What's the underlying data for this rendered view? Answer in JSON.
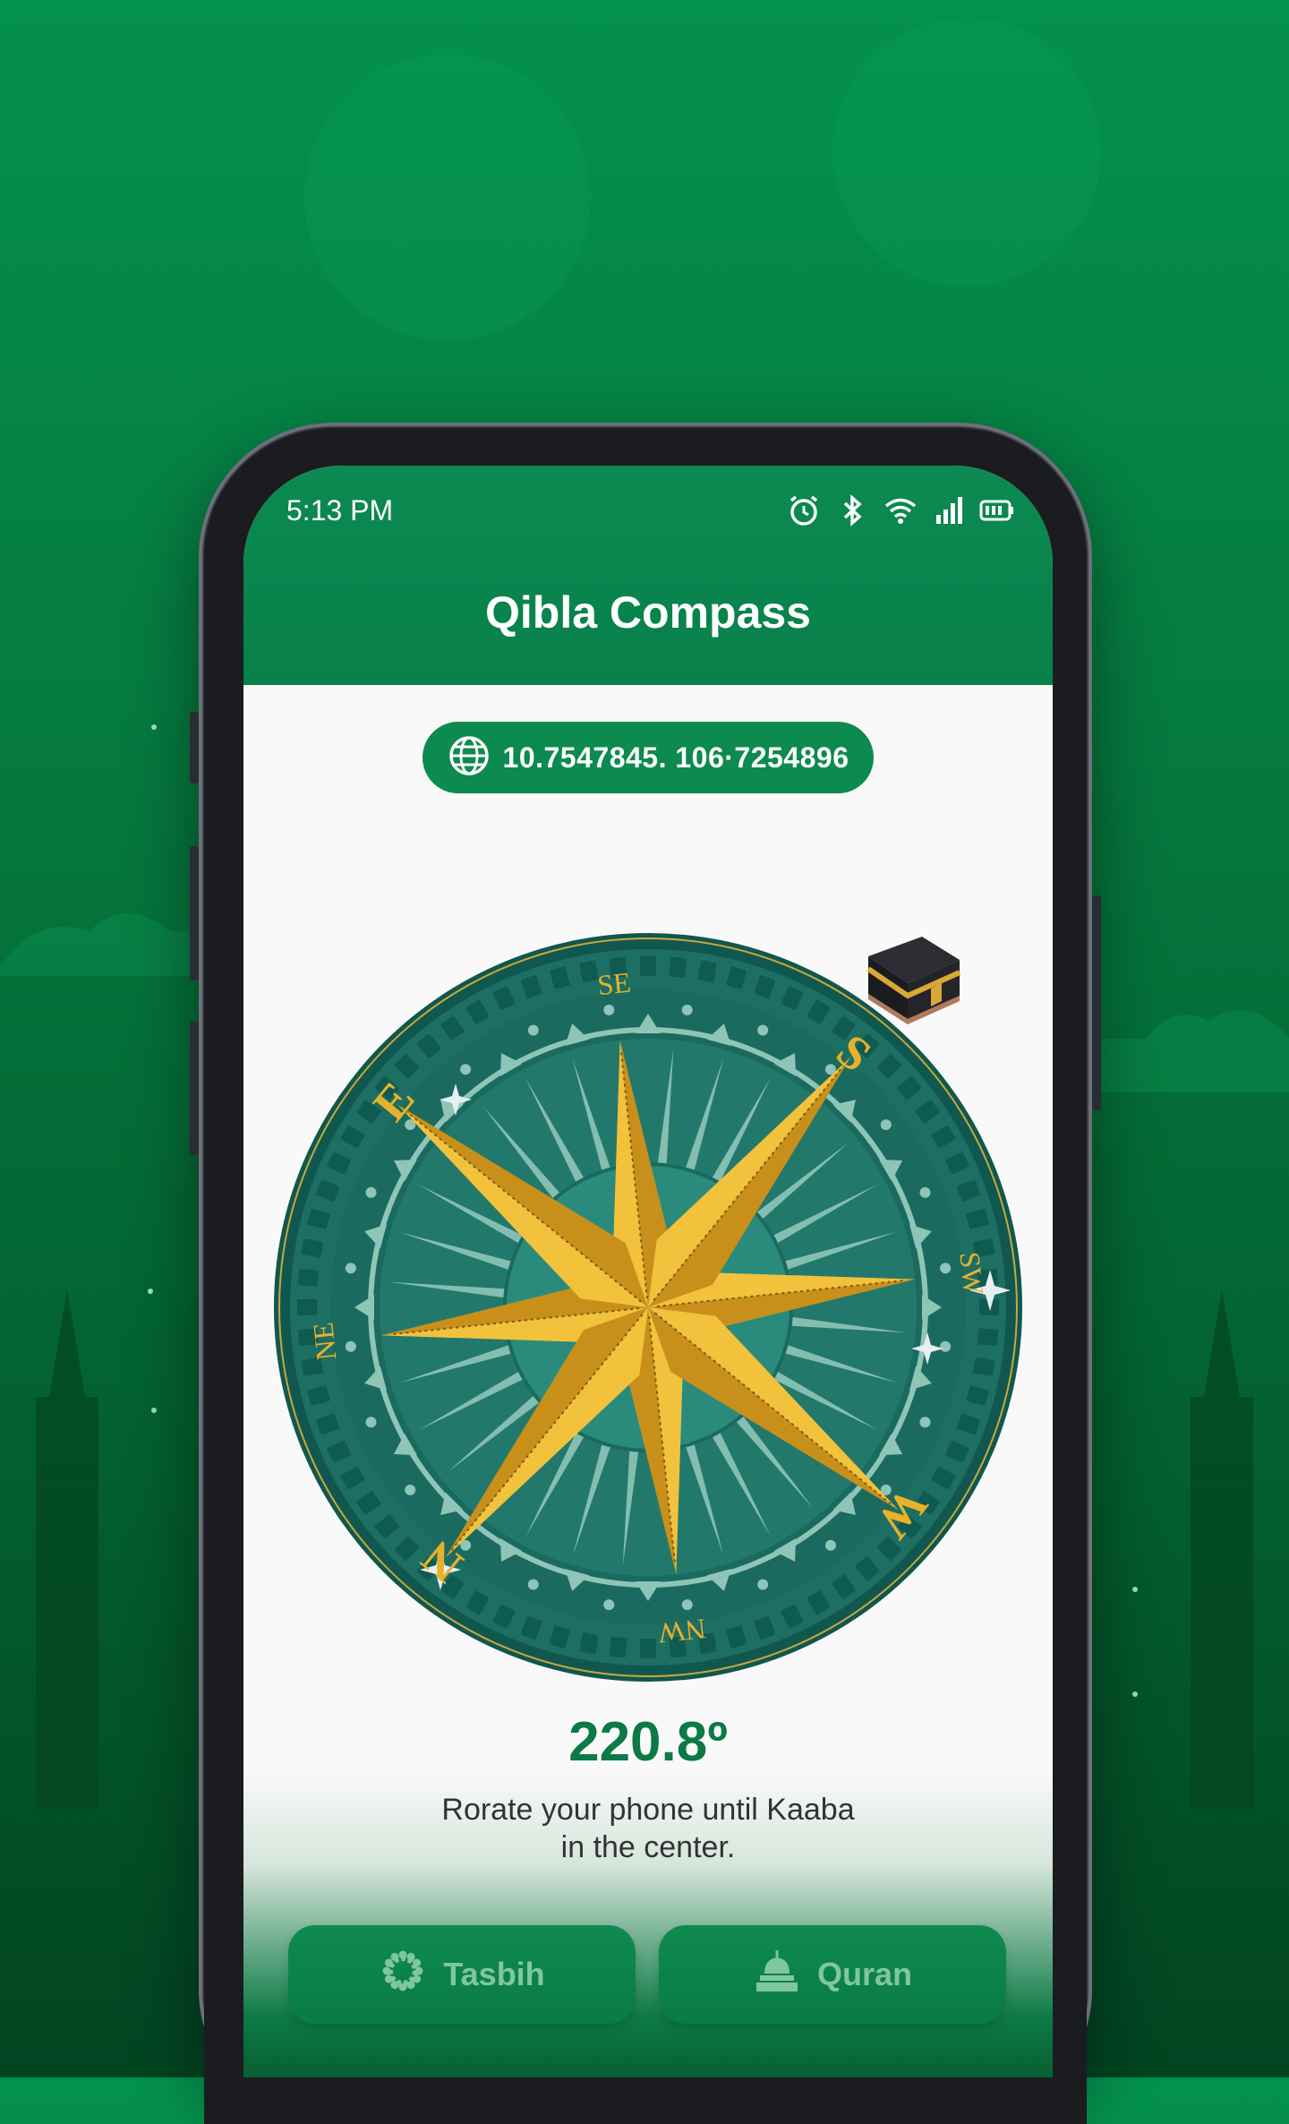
{
  "status_bar": {
    "time": "5:13 PM",
    "icons": [
      "alarm-icon",
      "bluetooth-icon",
      "wifi-icon",
      "signal-icon",
      "battery-icon"
    ]
  },
  "app": {
    "title": "Qibla Compass"
  },
  "location": {
    "coordinates": "10.7547845. 106·7254896",
    "icon": "globe-icon"
  },
  "compass": {
    "labels": [
      "N",
      "NE",
      "E",
      "SE",
      "S",
      "SW",
      "W",
      "NW"
    ],
    "heading": "220.8º",
    "qibla_icon": "kaaba-icon"
  },
  "instruction": {
    "line1": "Rorate your phone until Kaaba",
    "line2": "in the center."
  },
  "actions": [
    {
      "label": "Tasbih",
      "icon": "tasbih-beads-icon"
    },
    {
      "label": "Quran",
      "icon": "mosque-icon"
    }
  ],
  "colors": {
    "brand_green": "#0c8a52",
    "compass_teal": "#1b6f65",
    "compass_gold": "#e7b12a",
    "heading_text": "#0c7a46"
  }
}
